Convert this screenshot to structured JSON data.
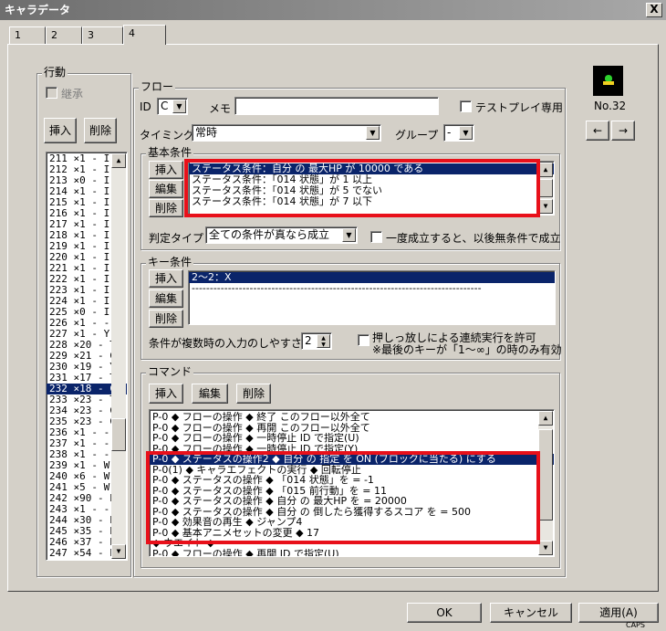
{
  "window": {
    "title": "キャラデータ",
    "close": "X"
  },
  "tabs": [
    "1",
    "2",
    "3",
    "4"
  ],
  "action": {
    "label": "行動",
    "inherit_label": "継承",
    "insert": "挿入",
    "delete": "削除",
    "items": [
      "211 ×1 - I",
      "212 ×1 - I",
      "213 ×0 - I",
      "214 ×1 - I",
      "215 ×1 - I",
      "216 ×1 - I",
      "217 ×1 - I",
      "218 ×1 - I",
      "219 ×1 - I",
      "220 ×1 - I",
      "221 ×1 - I",
      "222 ×1 - I",
      "223 ×1 - I",
      "224 ×1 - I",
      "225 ×0 - I",
      "226 ×1 - -",
      "227 ×1 - Y",
      "228 ×20 - T",
      "229 ×21 - C",
      "230 ×19 - Y",
      "231 ×17 - T",
      "232 ×18 - C",
      "233 ×23 - T",
      "234 ×23 - C",
      "235 ×23 - C",
      "236 ×1 - -",
      "237 ×1 - -",
      "238 ×1 - -",
      "239 ×1 - W",
      "240 ×6 - W",
      "241 ×5 - W",
      "242 ×90 - E",
      "243 ×1 - -",
      "244 ×30 - E",
      "245 ×35 - E",
      "246 ×37 - E",
      "247 ×54 - E"
    ],
    "selected_index": 21
  },
  "flow": {
    "label": "フロー",
    "id_label": "ID",
    "id_value": "C",
    "memo_label": "メモ",
    "memo_value": "",
    "testplay_label": "テストプレイ専用",
    "timing_label": "タイミング",
    "timing_value": "常時",
    "group_label": "グループ",
    "group_value": "-"
  },
  "basic": {
    "label": "基本条件",
    "insert": "挿入",
    "edit": "編集",
    "delete": "削除",
    "items": [
      "ステータス条件：自分 の 最大HP が 10000 である",
      "ステータス条件：「014 状態」が 1 以上",
      "ステータス条件：「014 状態」が 5 でない",
      "ステータス条件：「014 状態」が 7 以下"
    ],
    "judge_label": "判定タイプ",
    "judge_value": "全ての条件が真なら成立",
    "once_label": "一度成立すると、以後無条件で成立"
  },
  "key": {
    "label": "キー条件",
    "insert": "挿入",
    "edit": "編集",
    "delete": "削除",
    "items": [
      "2～2：X",
      "--------------------------------------------------------------------------------"
    ],
    "ease_label": "条件が複数時の入力のしやすさ",
    "ease_value": "2",
    "hold_label": "押しっ放しによる連続実行を許可",
    "hold_note": "※最後のキーが「1～∞」の時のみ有効"
  },
  "command": {
    "label": "コマンド",
    "insert": "挿入",
    "edit": "編集",
    "delete": "削除",
    "items": [
      "P-0 ◆ フローの操作 ◆ 終了 このフロー以外全て",
      "P-0 ◆ フローの操作 ◆ 再開 このフロー以外全て",
      "P-0 ◆ フローの操作 ◆ 一時停止 ID で指定(U)",
      "P-0 ◆ フローの操作 ◆ 一時停止 ID で指定(Y)",
      "P-0 ◆ ステータスの操作2 ◆ 自分 の 指定 を ON (ブロックに当たる) にする",
      "P-0(1) ◆ キャラエフェクトの実行 ◆ 回転停止",
      "P-0 ◆ ステータスの操作 ◆ 「014 状態」を = -1",
      "P-0 ◆ ステータスの操作 ◆ 「015 前行動」を = 11",
      "P-0 ◆ ステータスの操作 ◆ 自分 の 最大HP を = 20000",
      "P-0 ◆ ステータスの操作 ◆ 自分 の 倒したら獲得するスコア を = 500",
      "P-0 ◆ 効果音の再生 ◆ ジャンプ4",
      "P-0 ◆ 基本アニメセットの変更 ◆ 17",
      "◆ ウエイト ◆",
      "P-0 ◆ フローの操作 ◆ 再開 ID で指定(U)"
    ],
    "selected_index": 4
  },
  "preview": {
    "no_label": "No.32",
    "prev": "←",
    "next": "→"
  },
  "footer": {
    "ok": "OK",
    "cancel": "キャンセル",
    "apply": "適用(A)",
    "caps": "CAPS"
  }
}
